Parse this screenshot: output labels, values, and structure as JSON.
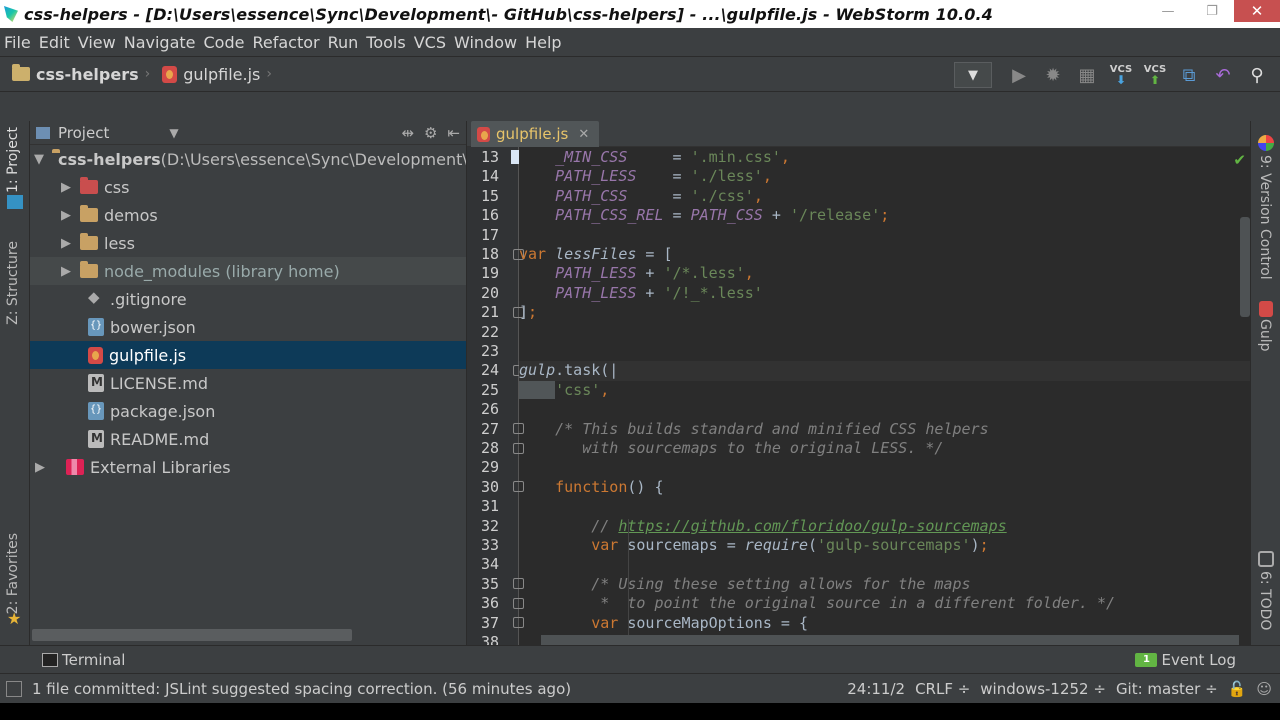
{
  "window": {
    "title": "css-helpers - [D:\\Users\\essence\\Sync\\Development\\- GitHub\\css-helpers] - ...\\gulpfile.js - WebStorm 10.0.4",
    "minimize": "—",
    "maximize": "❐",
    "close": "✕"
  },
  "menu": [
    "File",
    "Edit",
    "View",
    "Navigate",
    "Code",
    "Refactor",
    "Run",
    "Tools",
    "VCS",
    "Window",
    "Help"
  ],
  "breadcrumb": {
    "project": "css-helpers",
    "file": "gulpfile.js"
  },
  "toolbar": {
    "run_config": "▼",
    "vcs_update": "VCS",
    "vcs_commit": "VCS"
  },
  "left_stripe": {
    "project_tab": "1: Project",
    "structure_tab": "Z: Structure",
    "favorites_tab": "2: Favorites"
  },
  "right_stripe": {
    "version_control_tab": "9: Version Control",
    "gulp_tab": "Gulp",
    "todo_tab": "6: TODO"
  },
  "project_panel": {
    "header": "Project",
    "root_name": "css-helpers",
    "root_path": " (D:\\Users\\essence\\Sync\\Development\\-",
    "items": [
      {
        "label": "css"
      },
      {
        "label": "demos"
      },
      {
        "label": "less"
      },
      {
        "label": "node_modules (library home)"
      },
      {
        "label": ".gitignore"
      },
      {
        "label": "bower.json"
      },
      {
        "label": "gulpfile.js"
      },
      {
        "label": "LICENSE.md"
      },
      {
        "label": "package.json"
      },
      {
        "label": "README.md"
      }
    ],
    "external": "External Libraries"
  },
  "editor": {
    "tab_label": "gulpfile.js",
    "tab_close": "✕",
    "line_numbers": [
      "13",
      "14",
      "15",
      "16",
      "17",
      "18",
      "19",
      "20",
      "21",
      "22",
      "23",
      "24",
      "25",
      "26",
      "27",
      "28",
      "29",
      "30",
      "31",
      "32",
      "33",
      "34",
      "35",
      "36",
      "37",
      "38"
    ]
  },
  "bottom_bar": {
    "terminal": "Terminal",
    "event_log": "Event Log"
  },
  "status": {
    "message": "1 file committed: JSLint suggested spacing correction. (56 minutes ago)",
    "position": "24:11/2",
    "line_sep": "CRLF ÷",
    "encoding": "windows-1252 ÷",
    "vcs_branch": "Git: master ÷"
  },
  "colors": {
    "selection": "#0d3a58",
    "keyword": "#cc7832",
    "string": "#6a8759",
    "comment": "#808080"
  }
}
